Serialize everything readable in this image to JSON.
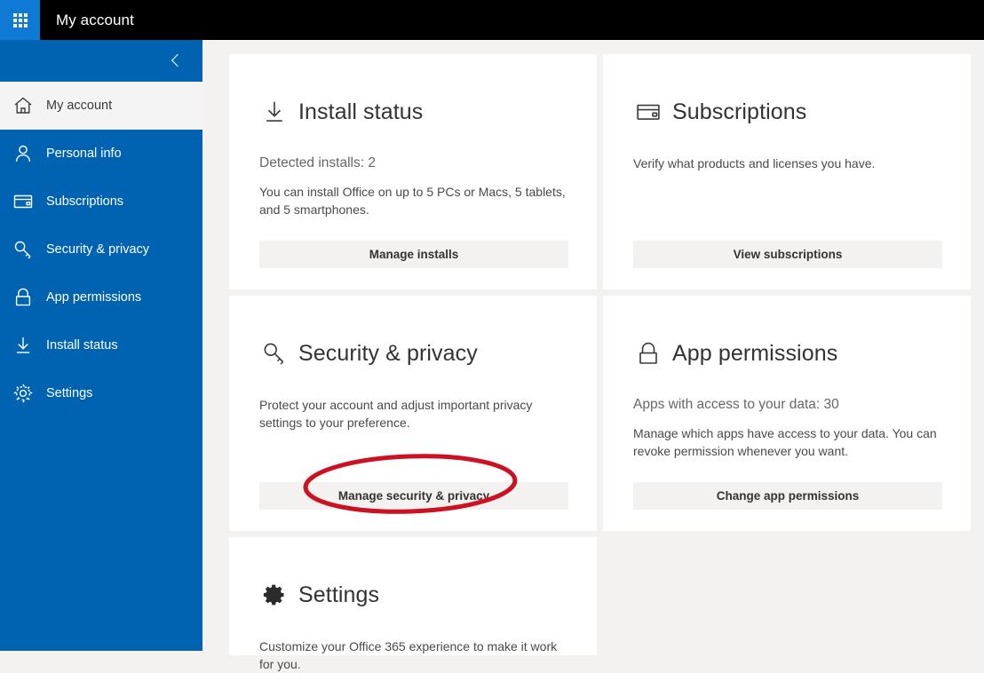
{
  "suite": {
    "waffle_icon": "app-launcher-waffle-icon",
    "title": "My account"
  },
  "sidebar": {
    "collapse_icon": "chevron-left-icon",
    "items": [
      {
        "label": "My account",
        "icon": "home-icon",
        "active": true
      },
      {
        "label": "Personal info",
        "icon": "person-icon",
        "active": false
      },
      {
        "label": "Subscriptions",
        "icon": "credit-card-icon",
        "active": false
      },
      {
        "label": "Security & privacy",
        "icon": "key-icon",
        "active": false
      },
      {
        "label": "App permissions",
        "icon": "lock-icon",
        "active": false
      },
      {
        "label": "Install status",
        "icon": "download-icon",
        "active": false
      },
      {
        "label": "Settings",
        "icon": "gear-icon",
        "active": false
      }
    ]
  },
  "cards": [
    {
      "id": "install-status",
      "icon": "download-icon",
      "title": "Install status",
      "stat": "Detected installs: 2",
      "description": "You can install Office on up to 5 PCs or Macs, 5 tablets, and 5 smartphones.",
      "button": "Manage installs"
    },
    {
      "id": "subscriptions",
      "icon": "credit-card-icon",
      "title": "Subscriptions",
      "stat": "",
      "description": "Verify what products and licenses you have.",
      "button": "View subscriptions"
    },
    {
      "id": "security-privacy",
      "icon": "key-icon",
      "title": "Security & privacy",
      "stat": "",
      "description": "Protect your account and adjust important privacy settings to your preference.",
      "button": "Manage security & privacy"
    },
    {
      "id": "app-permissions",
      "icon": "lock-icon",
      "title": "App permissions",
      "stat": "Apps with access to your data: 30",
      "description": "Manage which apps have access to your data. You can revoke permission whenever you want.",
      "button": "Change app permissions"
    },
    {
      "id": "settings",
      "icon": "gear-icon",
      "title": "Settings",
      "stat": "",
      "description": "Customize your Office 365 experience to make it work for you.",
      "button": ""
    }
  ],
  "annotation": {
    "shape": "ellipse-highlight",
    "target": "Manage security & privacy",
    "color": "#cc1122"
  },
  "colors": {
    "suite_bar": "#000000",
    "waffle": "#0f7ad4",
    "nav_blue": "#0063b1",
    "nav_active": "#f4f4f4",
    "page_bg": "#f3f2f1",
    "card_bg": "#ffffff",
    "button_bg": "#f3f2f1",
    "annotation_red": "#cc1122"
  }
}
